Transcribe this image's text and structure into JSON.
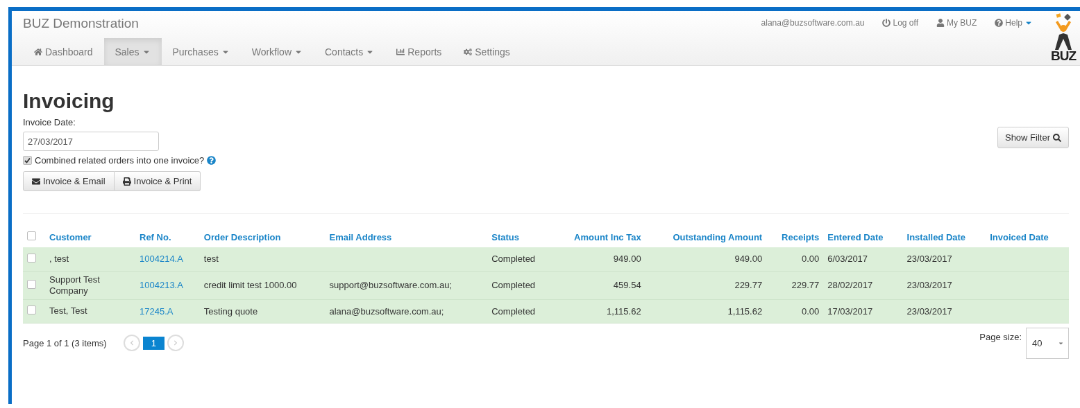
{
  "header": {
    "title": "BUZ Demonstration",
    "user_email": "alana@buzsoftware.com.au",
    "links": [
      {
        "kind": "link",
        "label": "Log off"
      },
      {
        "kind": "link",
        "label": "My BUZ"
      },
      {
        "kind": "dropdown",
        "label": "Help"
      }
    ],
    "logo_text": "BUZ"
  },
  "nav": [
    {
      "kind": "link",
      "label": "Dashboard",
      "selected": false
    },
    {
      "kind": "dropdown",
      "label": "Sales",
      "selected": true
    },
    {
      "kind": "dropdown",
      "label": "Purchases",
      "selected": false
    },
    {
      "kind": "dropdown",
      "label": "Workflow",
      "selected": false
    },
    {
      "kind": "dropdown",
      "label": "Contacts",
      "selected": false
    },
    {
      "kind": "link",
      "label": "Reports",
      "selected": false
    },
    {
      "kind": "link",
      "label": "Settings",
      "selected": false
    }
  ],
  "page": {
    "heading": "Invoicing",
    "date_label": "Invoice Date:",
    "date_value": "27/03/2017",
    "combine": {
      "label": "Combined related orders into one invoice?",
      "checked": true
    },
    "actions": [
      {
        "label": "Invoice & Email"
      },
      {
        "label": "Invoice & Print"
      }
    ],
    "show_filter": "Show Filter"
  },
  "table": {
    "select_all_checked": false,
    "columns": [
      "Customer",
      "Ref No.",
      "Order Description",
      "Email Address",
      "Status",
      "Amount Inc Tax",
      "Outstanding Amount",
      "Receipts",
      "Entered Date",
      "Installed Date",
      "Invoiced Date"
    ],
    "rows": [
      {
        "checked": false,
        "cells": [
          ", test",
          "1004214.A",
          "test",
          "",
          "Completed",
          "949.00",
          "949.00",
          "0.00",
          "6/03/2017",
          "23/03/2017",
          ""
        ]
      },
      {
        "checked": false,
        "cells": [
          "Support Test Company",
          "1004213.A",
          "credit limit test 1000.00",
          "support@buzsoftware.com.au;",
          "Completed",
          "459.54",
          "229.77",
          "229.77",
          "28/02/2017",
          "23/03/2017",
          ""
        ]
      },
      {
        "checked": false,
        "cells": [
          "Test, Test",
          "17245.A",
          "Testing quote",
          "alana@buzsoftware.com.au;",
          "Completed",
          "1,115.62",
          "1,115.62",
          "0.00",
          "17/03/2017",
          "23/03/2017",
          ""
        ]
      }
    ]
  },
  "pager": {
    "summary": "Page 1 of 1 (3 items)",
    "pages": [
      {
        "label": "1",
        "selected": true
      }
    ],
    "page_size_label": "Page size:",
    "page_size": "40"
  }
}
